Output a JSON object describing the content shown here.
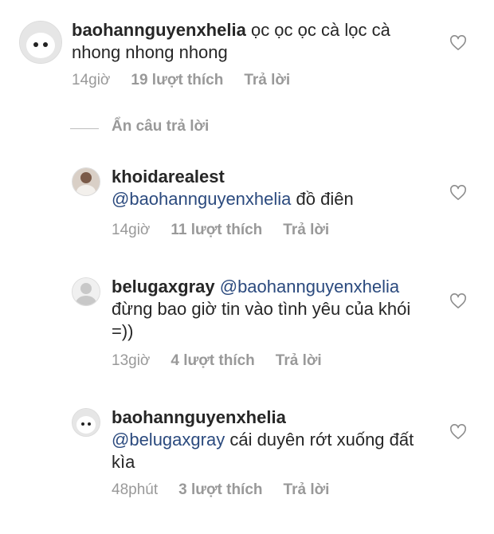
{
  "comments": [
    {
      "username": "baohannguyenxhelia",
      "mention": "",
      "text": "ọc ọc ọc cà lọc cà nhong nhong nhong",
      "time": "14giờ",
      "likes": "19 lượt thích",
      "reply": "Trả lời"
    },
    {
      "username": "khoidarealest",
      "mention": "@baohannguyenxhelia",
      "text": "đồ điên",
      "time": "14giờ",
      "likes": "11 lượt thích",
      "reply": "Trả lời"
    },
    {
      "username": "belugaxgray",
      "mention": "@baohannguyenxhelia",
      "text": "đừng bao giờ tin vào tình yêu của khói =))",
      "time": "13giờ",
      "likes": "4 lượt thích",
      "reply": "Trả lời"
    },
    {
      "username": "baohannguyenxhelia",
      "mention": "@belugaxgray",
      "text": "cái duyên rớt xuống đất kìa",
      "time": "48phút",
      "likes": "3 lượt thích",
      "reply": "Trả lời"
    }
  ],
  "replies_toggle": "Ẩn câu trả lời",
  "icons": {
    "like": "heart-outline-icon",
    "avatar_placeholder": "default-avatar-icon"
  },
  "colors": {
    "text": "#262626",
    "mention": "#2b4a7e",
    "meta": "#999999"
  }
}
